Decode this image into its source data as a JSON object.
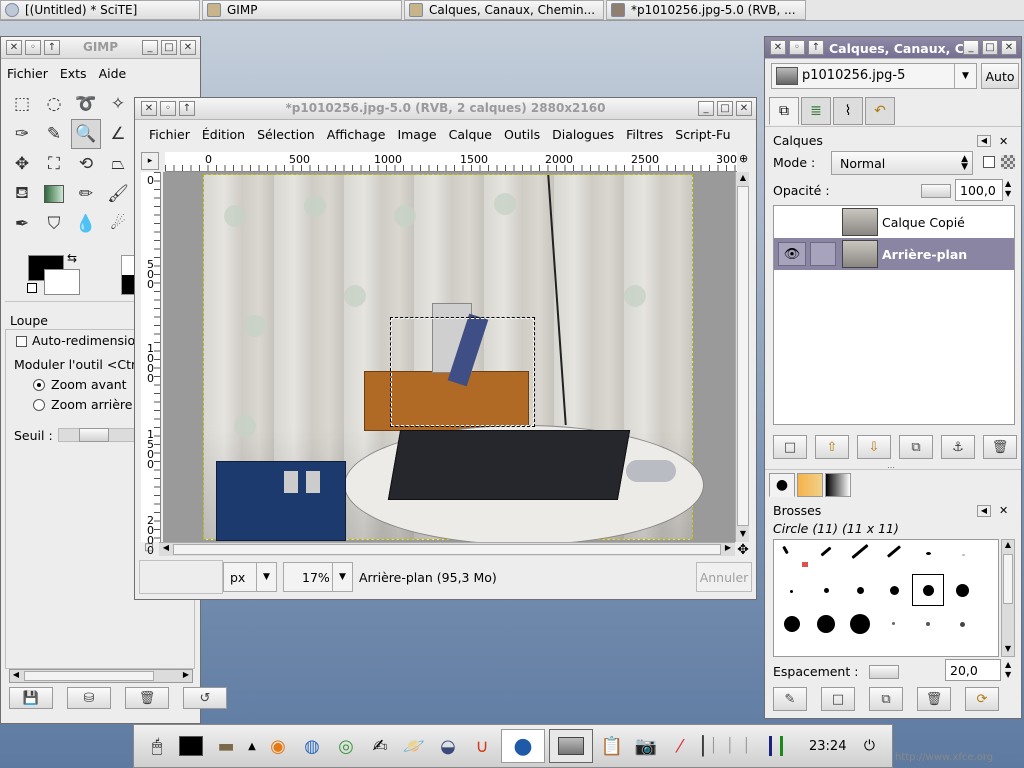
{
  "taskbar": {
    "items": [
      {
        "label": "[(Untitled) * SciTE]"
      },
      {
        "label": "GIMP"
      },
      {
        "label": "Calques, Canaux, Chemin..."
      },
      {
        "label": "*p1010256.jpg-5.0 (RVB, ..."
      }
    ]
  },
  "toolbox": {
    "title": "GIMP",
    "menu": [
      "Fichier",
      "Exts",
      "Aide"
    ],
    "options_title": "Loupe",
    "auto_resize_label": "Auto-redimensio",
    "modulate_label": "Moduler l'outil  <Ctr",
    "zoom_in_label": "Zoom avant",
    "zoom_out_label": "Zoom arrière",
    "threshold_label": "Seuil :"
  },
  "image_window": {
    "title": "*p1010256.jpg-5.0 (RVB, 2 calques) 2880x2160",
    "menu": [
      "Fichier",
      "Édition",
      "Sélection",
      "Affichage",
      "Image",
      "Calque",
      "Outils",
      "Dialogues",
      "Filtres",
      "Script-Fu"
    ],
    "ruler_h": [
      "0",
      "500",
      "1000",
      "1500",
      "2000",
      "2500",
      "300"
    ],
    "ruler_v": [
      "0",
      "500",
      "1000",
      "1500",
      "2000"
    ],
    "unit": "px",
    "zoom": "17%",
    "status": "Arrière-plan (95,3 Mo)",
    "cancel_label": "Annuler"
  },
  "layers_dock": {
    "title": "Calques, Canaux, C",
    "image_select": "p1010256.jpg-5",
    "auto_label": "Auto",
    "section_title": "Calques",
    "mode_label": "Mode :",
    "mode_value": "Normal",
    "opacity_label": "Opacité :",
    "opacity_value": "100,0",
    "layers": [
      {
        "name": "Calque Copié",
        "visible": false,
        "selected": false
      },
      {
        "name": "Arrière-plan",
        "visible": true,
        "selected": true
      }
    ],
    "brushes_title": "Brosses",
    "brush_name": "Circle (11) (11 x 11)",
    "spacing_label": "Espacement :",
    "spacing_value": "20,0"
  },
  "panel": {
    "clock": "23:24",
    "watermark": "http://www.xfce.org"
  },
  "colors": {
    "layer_selected": "#8b85a4",
    "titlebar_text": "#9a9a9a"
  }
}
